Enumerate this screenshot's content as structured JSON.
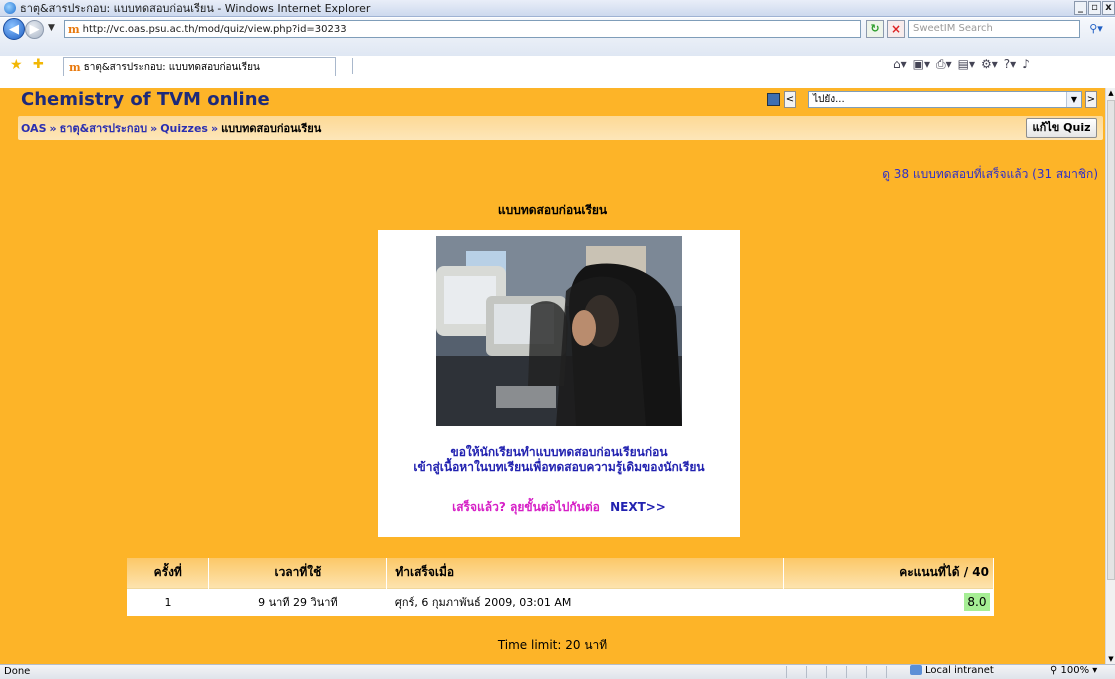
{
  "window": {
    "title": "ธาตุ&สารประกอบ: แบบทดสอบก่อนเรียน - Windows Internet Explorer"
  },
  "browser": {
    "address": "http://vc.oas.psu.ac.th/mod/quiz/view.php?id=30233",
    "search_placeholder": "SweetIM Search",
    "tab_title": "ธาตุ&สารประกอบ: แบบทดสอบก่อนเรียน"
  },
  "site": {
    "title": "Chemistry of TVM online",
    "jump_select": "ไปยัง..."
  },
  "breadcrumb": {
    "items": [
      "OAS",
      "ธาตุ&สารประกอบ",
      "Quizzes"
    ],
    "separator": "»",
    "current": "แบบทดสอบก่อนเรียน"
  },
  "edit_button": "แก้ไข Quiz",
  "attempts_link": "ดู 38 แบบทดสอบที่เสร็จแล้ว (31 สมาชิก)",
  "quiz": {
    "name": "แบบทดสอบก่อนเรียน",
    "intro_line1": "ขอให้นักเรียนทำแบบทดสอบก่อนเรียนก่อน",
    "intro_line2": "เข้าสู่เนื้อหาในบทเรียนเพื่อทดสอบความรู้เดิมของนักเรียน",
    "cta_text": "เสร็จแล้ว? ลุยขั้นต่อไปกันต่อ",
    "cta_next": "NEXT>>",
    "time_limit": "Time limit: 20 นาที"
  },
  "attempts_table": {
    "headers": [
      "ครั้งที่",
      "เวลาที่ใช้",
      "ทำเสร็จเมื่อ",
      "คะแนนที่ได้ / 40"
    ],
    "rows": [
      {
        "attempt": "1",
        "time_taken": "9 นาที 29 วินาที",
        "completed": "ศุกร์, 6 กุมภาพันธ์ 2009, 03:01 AM",
        "grade": "8.0"
      }
    ]
  },
  "status": {
    "text": "Done",
    "zone": "Local intranet",
    "zoom": "100%"
  },
  "colors": {
    "page_background": "#fdb428",
    "link": "#2b2fb0",
    "cta_magenta": "#d61fc6",
    "grade_highlight": "#a6ee95"
  }
}
